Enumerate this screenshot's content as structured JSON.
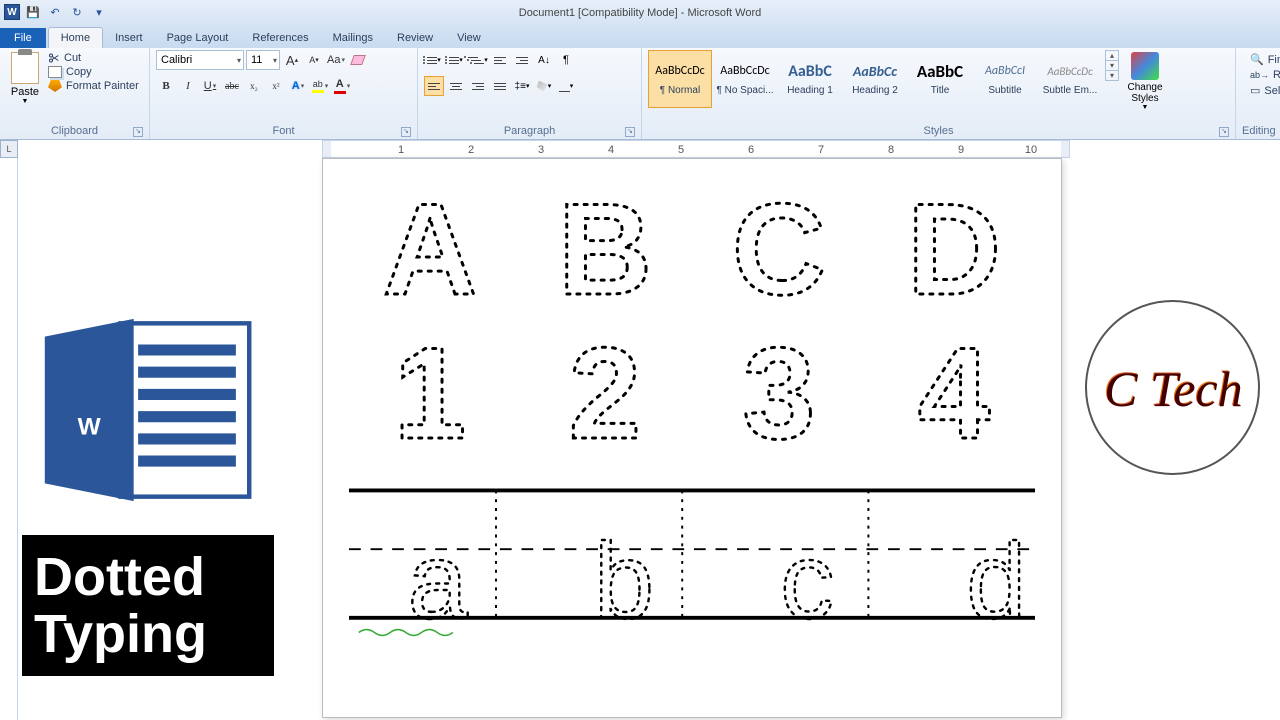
{
  "title": "Document1 [Compatibility Mode] - Microsoft Word",
  "qat": {
    "save": "💾",
    "undo": "↶",
    "redo": "↻"
  },
  "tabs": {
    "file": "File",
    "home": "Home",
    "insert": "Insert",
    "pagelayout": "Page Layout",
    "references": "References",
    "mailings": "Mailings",
    "review": "Review",
    "view": "View"
  },
  "clipboard": {
    "paste": "Paste",
    "cut": "Cut",
    "copy": "Copy",
    "formatpainter": "Format Painter",
    "label": "Clipboard"
  },
  "font": {
    "name": "Calibri",
    "size": "11",
    "growA": "A",
    "shrinkA": "A",
    "changecase": "Aa",
    "clear": "⌫",
    "bold": "B",
    "italic": "I",
    "underline": "U",
    "strike": "abc",
    "sub": "x₂",
    "sup": "x²",
    "texteffects": "A",
    "highlight": "ab",
    "fontcolor": "A",
    "label": "Font"
  },
  "paragraph": {
    "label": "Paragraph"
  },
  "styles": {
    "label": "Styles",
    "items": [
      {
        "preview": "AaBbCcDc",
        "name": "¶ Normal",
        "sel": true,
        "css": "font-size:12px;"
      },
      {
        "preview": "AaBbCcDc",
        "name": "¶ No Spaci...",
        "css": "font-size:12px;"
      },
      {
        "preview": "AaBbC",
        "name": "Heading 1",
        "css": "font-size:16px;font-weight:bold;color:#365f91;"
      },
      {
        "preview": "AaBbCc",
        "name": "Heading 2",
        "css": "font-size:14px;font-weight:bold;font-style:italic;color:#365f91;"
      },
      {
        "preview": "AaBbC",
        "name": "Title",
        "css": "font-size:17px;font-weight:bold;"
      },
      {
        "preview": "AaBbCcI",
        "name": "Subtitle",
        "css": "font-size:12px;font-style:italic;color:#4f6d94;"
      },
      {
        "preview": "AaBbCcDc",
        "name": "Subtle Em...",
        "css": "font-size:11px;font-style:italic;color:#888;"
      }
    ],
    "changestyles": "Change Styles"
  },
  "editing": {
    "find": "Find",
    "replace": "Replace",
    "select": "Select",
    "label": "Editing"
  },
  "document": {
    "row1": [
      "A",
      "B",
      "C",
      "D"
    ],
    "row2": [
      "1",
      "2",
      "3",
      "4"
    ],
    "trace": [
      "a",
      "b",
      "c",
      "d"
    ]
  },
  "overlay": {
    "dotted": "Dotted\nTyping",
    "ctech": "C Tech"
  }
}
